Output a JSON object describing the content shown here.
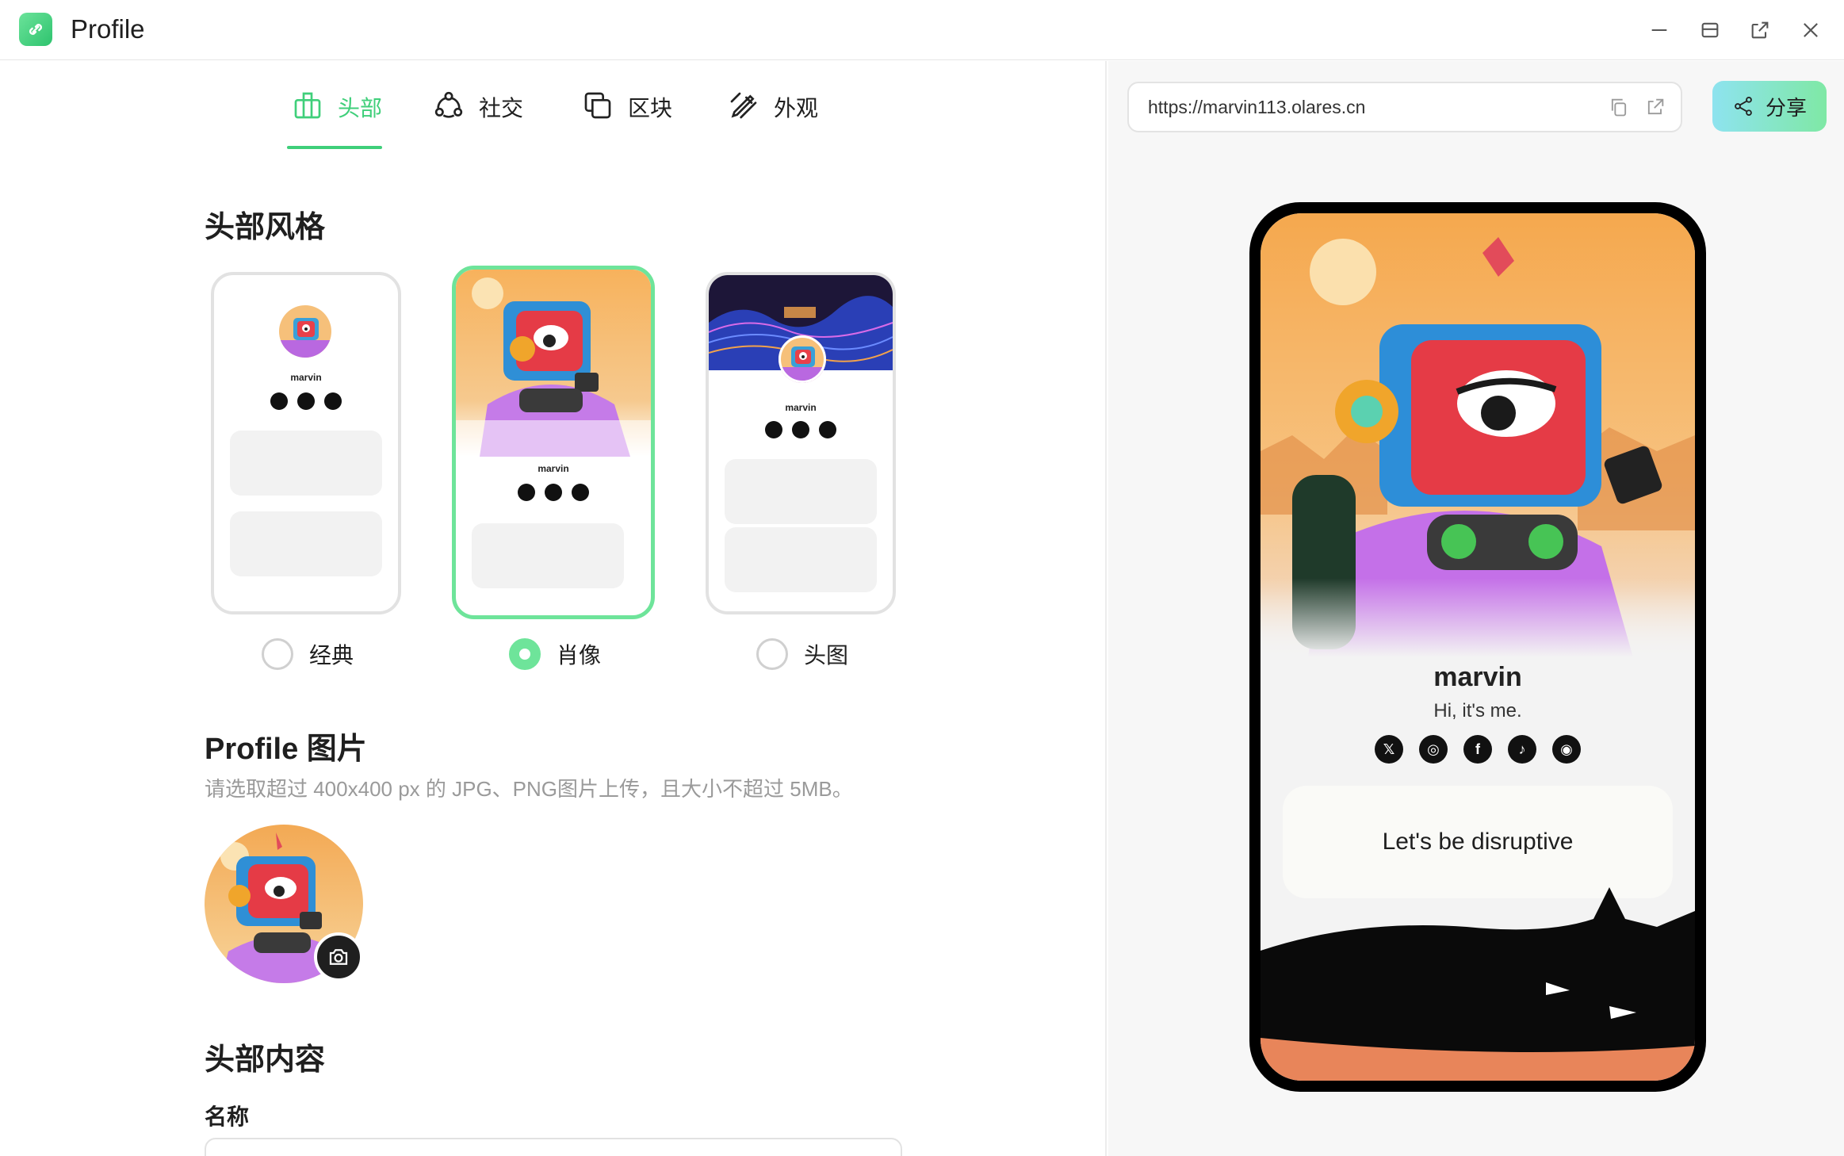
{
  "window": {
    "title": "Profile"
  },
  "tabs": [
    {
      "label": "头部",
      "icon": "layout-icon",
      "active": true
    },
    {
      "label": "社交",
      "icon": "social-icon",
      "active": false
    },
    {
      "label": "区块",
      "icon": "blocks-icon",
      "active": false
    },
    {
      "label": "外观",
      "icon": "appearance-icon",
      "active": false
    }
  ],
  "header_style": {
    "title": "头部风格",
    "options": [
      {
        "label": "经典",
        "selected": false,
        "mini_name": "marvin"
      },
      {
        "label": "肖像",
        "selected": true,
        "mini_name": "marvin"
      },
      {
        "label": "头图",
        "selected": false,
        "mini_name": "marvin"
      }
    ]
  },
  "profile_image": {
    "title": "Profile 图片",
    "hint": "请选取超过 400x400 px 的 JPG、PNG图片上传，且大小不超过 5MB。"
  },
  "header_content": {
    "title": "头部内容",
    "name_label": "名称"
  },
  "preview": {
    "url": "https://marvin113.olares.cn",
    "share_label": "分享",
    "name": "marvin",
    "bio": "Hi, it's me.",
    "social_icons": [
      "x-icon",
      "instagram-icon",
      "facebook-icon",
      "tiktok-icon",
      "github-icon"
    ],
    "link_block": "Let's be disruptive"
  },
  "colors": {
    "accent": "#3fcf7a",
    "accent_light": "#6ee49a",
    "share_gradient_start": "#8ee3ef",
    "share_gradient_end": "#7fe8a5"
  }
}
